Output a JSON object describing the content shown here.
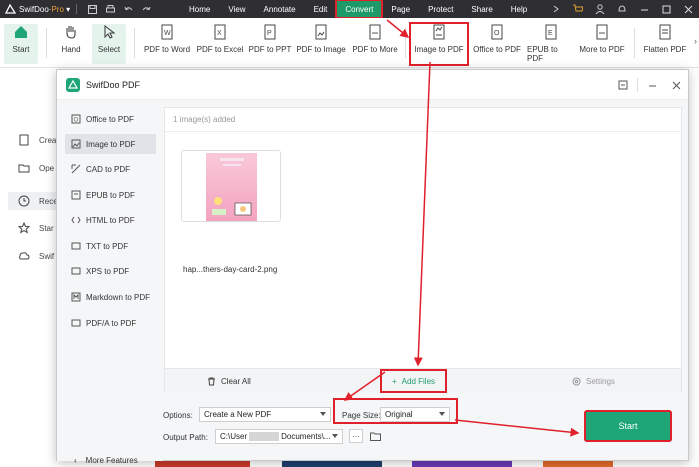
{
  "app": {
    "name": "SwifDoo",
    "edition": "Pro"
  },
  "menu": [
    "Home",
    "View",
    "Annotate",
    "Edit",
    "Convert",
    "Page",
    "Protect",
    "Share",
    "Help"
  ],
  "menu_active": "Convert",
  "ribbon": {
    "start": "Start",
    "hand": "Hand",
    "select": "Select",
    "tools": [
      "PDF to Word",
      "PDF to Excel",
      "PDF to PPT",
      "PDF to Image",
      "PDF to More",
      "Image to PDF",
      "Office to PDF",
      "EPUB to PDF",
      "More to PDF",
      "Flatten PDF"
    ]
  },
  "background_nav": [
    "Crea",
    "Ope",
    "Rece",
    "Star",
    "Swif"
  ],
  "dialog": {
    "title": "SwifDoo PDF",
    "sidebar": [
      {
        "label": "Office to PDF",
        "icon": "office-icon"
      },
      {
        "label": "Image to PDF",
        "icon": "image-icon"
      },
      {
        "label": "CAD to PDF",
        "icon": "cad-icon"
      },
      {
        "label": "EPUB to PDF",
        "icon": "epub-icon"
      },
      {
        "label": "HTML to PDF",
        "icon": "html-icon"
      },
      {
        "label": "TXT to PDF",
        "icon": "txt-icon"
      },
      {
        "label": "XPS to PDF",
        "icon": "xps-icon"
      },
      {
        "label": "Markdown to PDF",
        "icon": "markdown-icon"
      },
      {
        "label": "PDF/A to PDF",
        "icon": "pdfa-icon"
      }
    ],
    "sidebar_active": "Image to PDF",
    "more_features": "More Features",
    "count_text": "1 image(s) added",
    "file_name": "hap...thers-day-card-2.png",
    "clear_all": "Clear All",
    "add_files": "Add Files",
    "settings": "Settings",
    "options_label": "Options:",
    "options_value": "Create a New PDF",
    "page_size_label": "Page Size:",
    "page_size_value": "Original",
    "output_label": "Output Path:",
    "output_prefix": "C:\\User",
    "output_suffix": "Documents\\...",
    "browse": "···",
    "start": "Start"
  },
  "colors": {
    "accent": "#1ea678",
    "highlight": "#e0202a",
    "titlebar": "#2f2f33"
  }
}
